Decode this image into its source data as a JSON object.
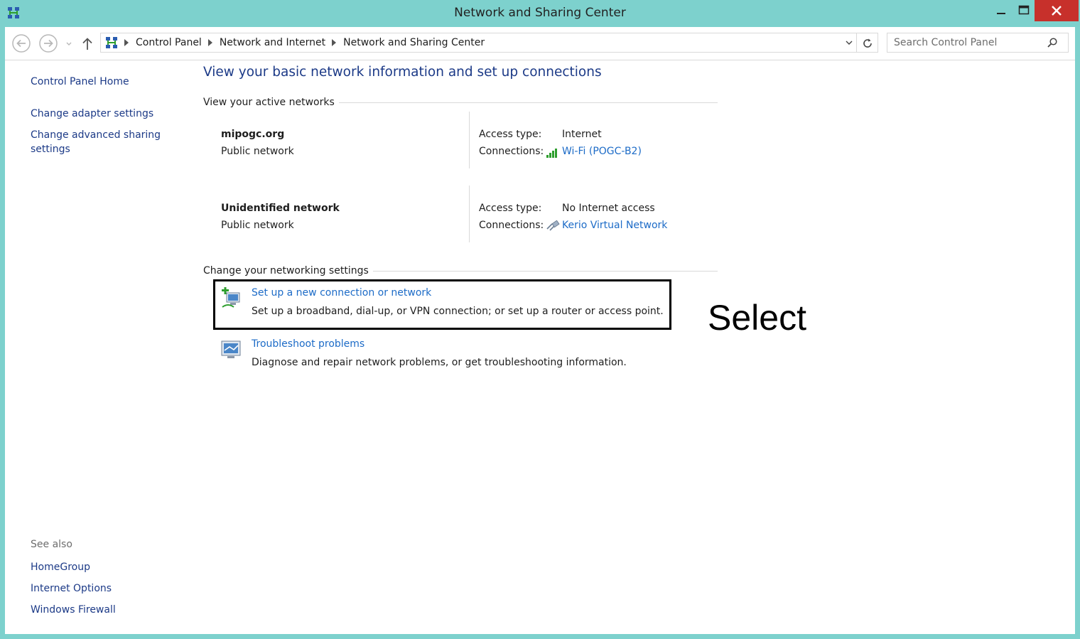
{
  "window": {
    "title": "Network and Sharing Center",
    "icons": {
      "app": "network-sharing-icon",
      "minimize": "minimize-icon",
      "maximize": "maximize-icon",
      "close": "close-icon"
    }
  },
  "addressbar": {
    "breadcrumbs": [
      "Control Panel",
      "Network and Internet",
      "Network and Sharing Center"
    ],
    "search_placeholder": "Search Control Panel",
    "icons": {
      "back": "back-arrow-icon",
      "forward": "forward-arrow-icon",
      "up": "up-arrow-icon",
      "refresh": "refresh-icon",
      "search": "search-icon"
    }
  },
  "left_pane": {
    "links": [
      "Control Panel Home",
      "Change adapter settings",
      "Change advanced sharing settings"
    ],
    "see_also_heading": "See also",
    "see_also": [
      "HomeGroup",
      "Internet Options",
      "Windows Firewall"
    ]
  },
  "main": {
    "title": "View your basic network information and set up connections",
    "active_networks_heading": "View your active networks",
    "networks": [
      {
        "name": "mipogc.org",
        "category": "Public network",
        "access_type_label": "Access type:",
        "access_type": "Internet",
        "connections_label": "Connections:",
        "connection": "Wi-Fi (POGC-B2)",
        "connection_icon": "wifi-signal-icon"
      },
      {
        "name": "Unidentified network",
        "category": "Public network",
        "access_type_label": "Access type:",
        "access_type": "No Internet access",
        "connections_label": "Connections:",
        "connection": "Kerio Virtual Network",
        "connection_icon": "ethernet-cable-icon"
      }
    ],
    "change_settings_heading": "Change your networking settings",
    "tasks": [
      {
        "link": "Set up a new connection or network",
        "description": "Set up a broadband, dial-up, or VPN connection; or set up a router or access point.",
        "icon": "new-connection-icon"
      },
      {
        "link": "Troubleshoot problems",
        "description": "Diagnose and repair network problems, or get troubleshooting information.",
        "icon": "troubleshoot-icon"
      }
    ]
  },
  "annotation": {
    "text": "Select"
  },
  "colors": {
    "window_frame": "#7dd1cd",
    "link_dark": "#1c3a87",
    "link": "#1c6bc7",
    "close_button": "#c7302b",
    "wifi_bars": "#2e9e2e"
  }
}
